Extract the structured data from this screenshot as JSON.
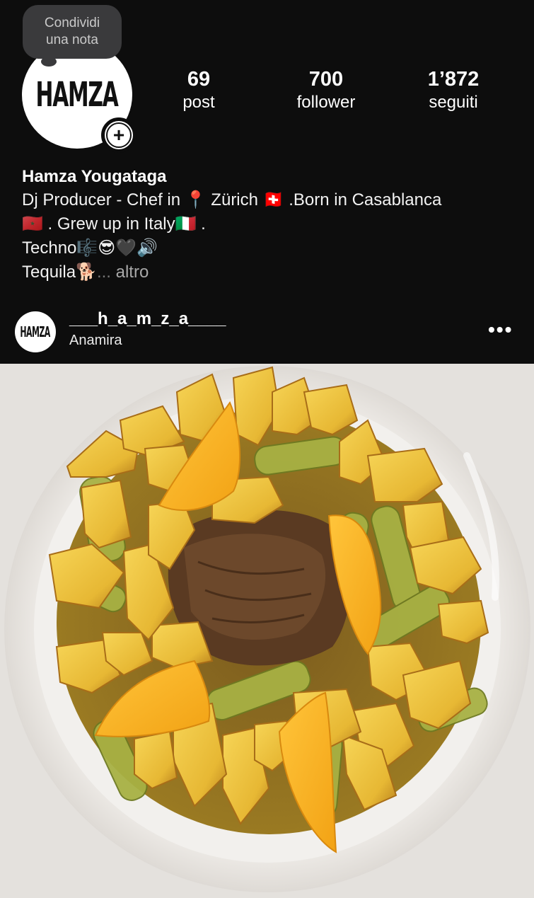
{
  "note": {
    "text_line1": "Condividi",
    "text_line2": "una nota"
  },
  "avatar": {
    "logo_text": "HAMZA",
    "badge_symbol": "+"
  },
  "stats": {
    "posts": {
      "count": "69",
      "label": "post"
    },
    "followers": {
      "count": "700",
      "label": "follower"
    },
    "following": {
      "count": "1’872",
      "label": "seguiti"
    }
  },
  "bio": {
    "name": "Hamza Yougataga",
    "line1": "Dj Producer - Chef in 📍 Zürich 🇨🇭 .Born in Casablanca",
    "line2": "🇲🇦 . Grew up in Italy🇮🇹 .",
    "line3": "Techno🎼😎🖤🔊",
    "line4_prefix": "Tequila🐕",
    "line4_ellipsis": "...",
    "more": "altro"
  },
  "post": {
    "avatar_logo": "HAMZA",
    "username": "___h_a_m_z_a____",
    "location": "Anamira",
    "more_label": "•••"
  },
  "colors": {
    "background": "#0d0d0d",
    "note_bubble": "#3a3a3c",
    "plate": "#f3f1ee"
  },
  "icons": {
    "more": "more-horizontal-icon",
    "add": "plus-icon"
  }
}
